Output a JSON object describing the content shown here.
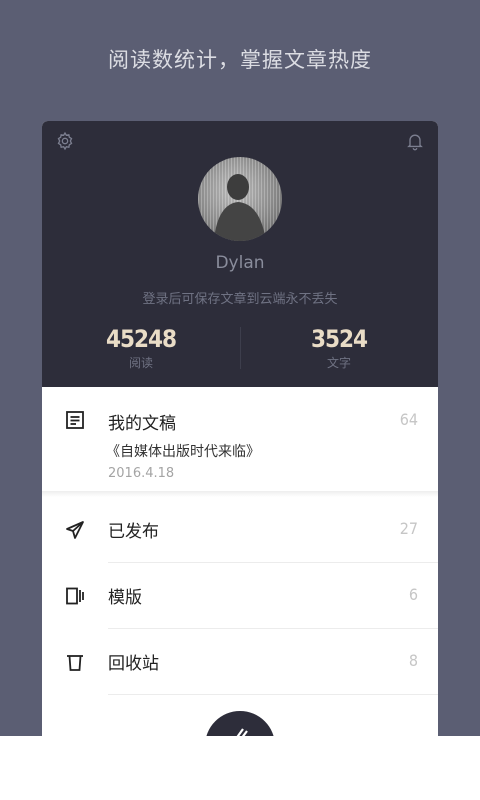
{
  "headline": "阅读数统计，掌握文章热度",
  "profile": {
    "username": "Dylan",
    "login_hint": "登录后可保存文章到云端永不丢失",
    "stats": [
      {
        "value": "45248",
        "label": "阅读"
      },
      {
        "value": "3524",
        "label": "文字"
      }
    ]
  },
  "draft": {
    "label": "我的文稿",
    "count": "64",
    "article_title": "《自媒体出版时代来临》",
    "date": "2016.4.18"
  },
  "menu": [
    {
      "label": "已发布",
      "count": "27",
      "icon": "send-icon"
    },
    {
      "label": "模版",
      "count": "6",
      "icon": "template-icon"
    },
    {
      "label": "回收站",
      "count": "8",
      "icon": "trash-icon"
    }
  ],
  "colors": {
    "background": "#5b5e73",
    "profile_bg": "#2d2d3a",
    "stat_value": "#e9dcc6"
  }
}
